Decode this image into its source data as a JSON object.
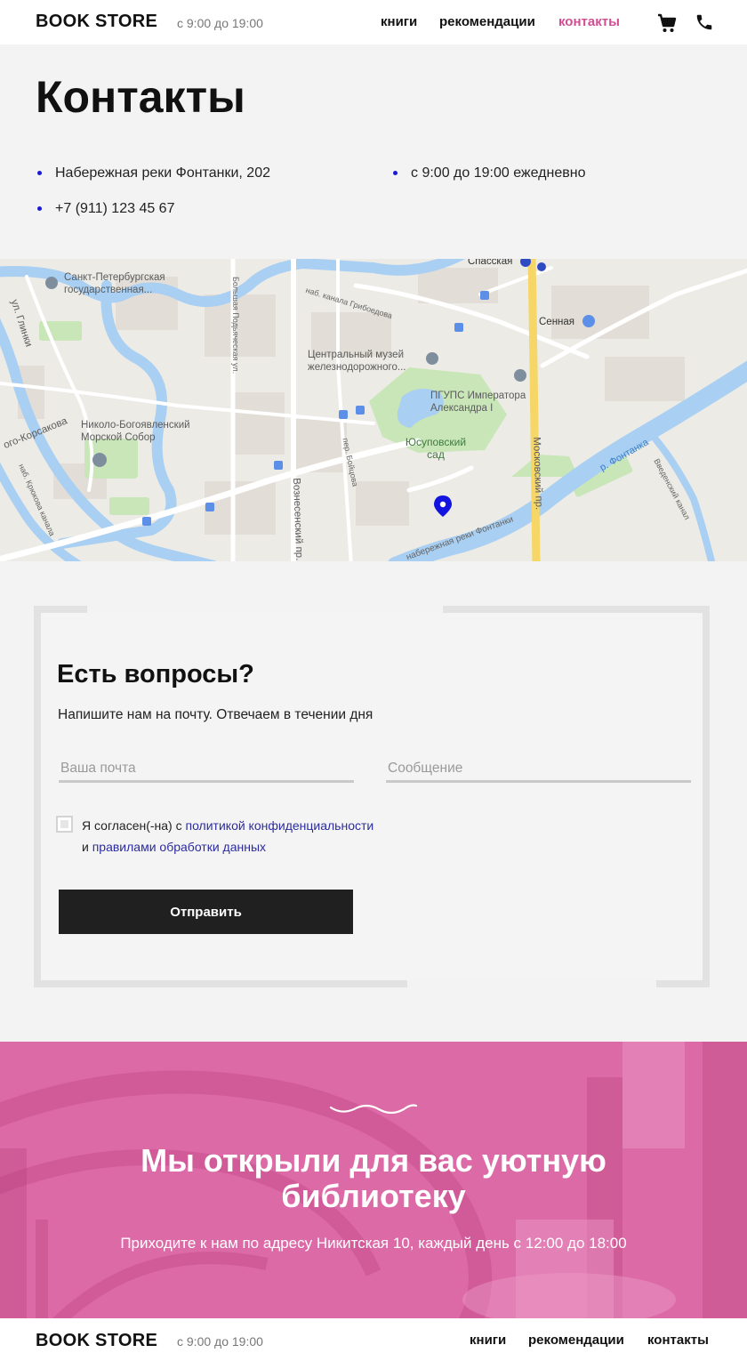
{
  "header": {
    "logo": "BOOK STORE",
    "hours": "с 9:00 до 19:00",
    "nav": [
      {
        "label": "книги"
      },
      {
        "label": "рекомендации"
      },
      {
        "label": "контакты"
      }
    ],
    "cart_icon": "cart-icon",
    "phone_icon": "phone-icon"
  },
  "contacts": {
    "title": "Контакты",
    "address": "Набережная реки Фонтанки, 202",
    "schedule": "с 9:00 до 19:00 ежедневно",
    "phone": "+7 (911) 123 45 67"
  },
  "map": {
    "labels": {
      "spasskaya": "Спасская",
      "university": "Санкт-Петербургская государственная...",
      "griboedov": "наб. канала Грибоедова",
      "sennaya": "Сенная",
      "glinki": "ул. Глинки",
      "museum": "Центральный музей железнодорожного...",
      "pgups": "ПГУПС Императора Александра I",
      "sobor": "Николо-Богоявленский Морской Собор",
      "korsakova": "ого-Корсакова",
      "yusupov": "Юсуповский сад",
      "fontanka": "р. Фонтанка",
      "moskovsky": "Московский пр.",
      "voznesensky": "Вознесенский пр.",
      "boitsova": "пер. Бойцова",
      "naberezhnaya": "набережная реки Фонтанки",
      "vvedensky": "Введенский канал",
      "kryukov": "наб. Крюкова канала",
      "podyacheskaya": "Большая Подьяческая ул."
    }
  },
  "form": {
    "title": "Есть вопросы?",
    "subtitle": "Напишите нам на почту. Отвечаем в течении дня",
    "email_placeholder": "Ваша почта",
    "message_placeholder": "Сообщение",
    "consent_prefix": "Я согласен(-на) с ",
    "consent_link1": "политикой конфиденциальности",
    "consent_middle": "и ",
    "consent_link2": "правилами обработки данных",
    "submit_label": "Отправить"
  },
  "banner": {
    "title": "Мы открыли для вас уютную библиотеку",
    "subtitle": "Приходите к нам по адресу Никитская 10, каждый день с 12:00 до 18:00"
  },
  "footer": {
    "logo": "BOOK STORE",
    "hours": "с 9:00 до 19:00",
    "nav": [
      {
        "label": "книги"
      },
      {
        "label": "рекомендации"
      },
      {
        "label": "контакты"
      }
    ]
  },
  "colors": {
    "accent": "#d04e93",
    "banner": "#dc6aa6",
    "button": "#202020",
    "bullet": "#1a1ad6"
  }
}
